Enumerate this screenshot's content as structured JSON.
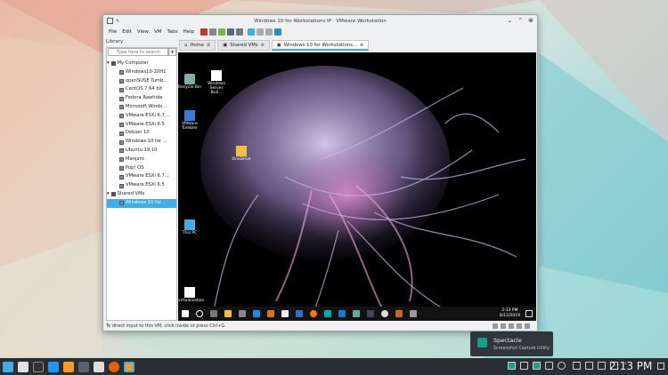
{
  "window": {
    "title": "Windows 10  for Workstations IP - VMware Workstation",
    "menu": [
      "File",
      "Edit",
      "View",
      "VM",
      "Tabs",
      "Help"
    ]
  },
  "library": {
    "label": "Library",
    "search_placeholder": "Type here to search",
    "root": "My Computer",
    "vms": [
      "Windows10-20H1",
      "openSUSE Tumb...",
      "CentOS 7 64 bit",
      "Fedora Rawhide",
      "Microsoft Windo...",
      "VMware ESXi 6.7...",
      "VMware ESXi 6.5",
      "Debian 10",
      "Windows 10 for ...",
      "Ubuntu 19.10",
      "Manjaro",
      "Pop! OS",
      "VMware ESXi 6.7...",
      "VMware ESXi 6.5"
    ],
    "shared": "Shared VMs",
    "selected": "Windows 10  for..."
  },
  "tabs": [
    {
      "label": "Home"
    },
    {
      "label": "Shared VMs"
    },
    {
      "label": "Windows 10  for Workstations..."
    }
  ],
  "guest": {
    "icons": {
      "recycle": "Recycle Bin",
      "server": "Windows Server Buil...",
      "vmware": "VMware Tumbler",
      "onedrive": "OneDrive",
      "thispc": "This PC",
      "virt": "virtualization"
    },
    "clock_time": "2:13 PM",
    "clock_date": "8/12/2019"
  },
  "status_text": "To direct input to this VM, click inside or press Ctrl+G.",
  "notification": {
    "title": "Spectacle",
    "subtitle": "Screenshot Capture Utility"
  },
  "host_clock": "2:13 PM",
  "colors": {
    "accent": "#3daee9",
    "taskbar": "#2a2e32"
  }
}
